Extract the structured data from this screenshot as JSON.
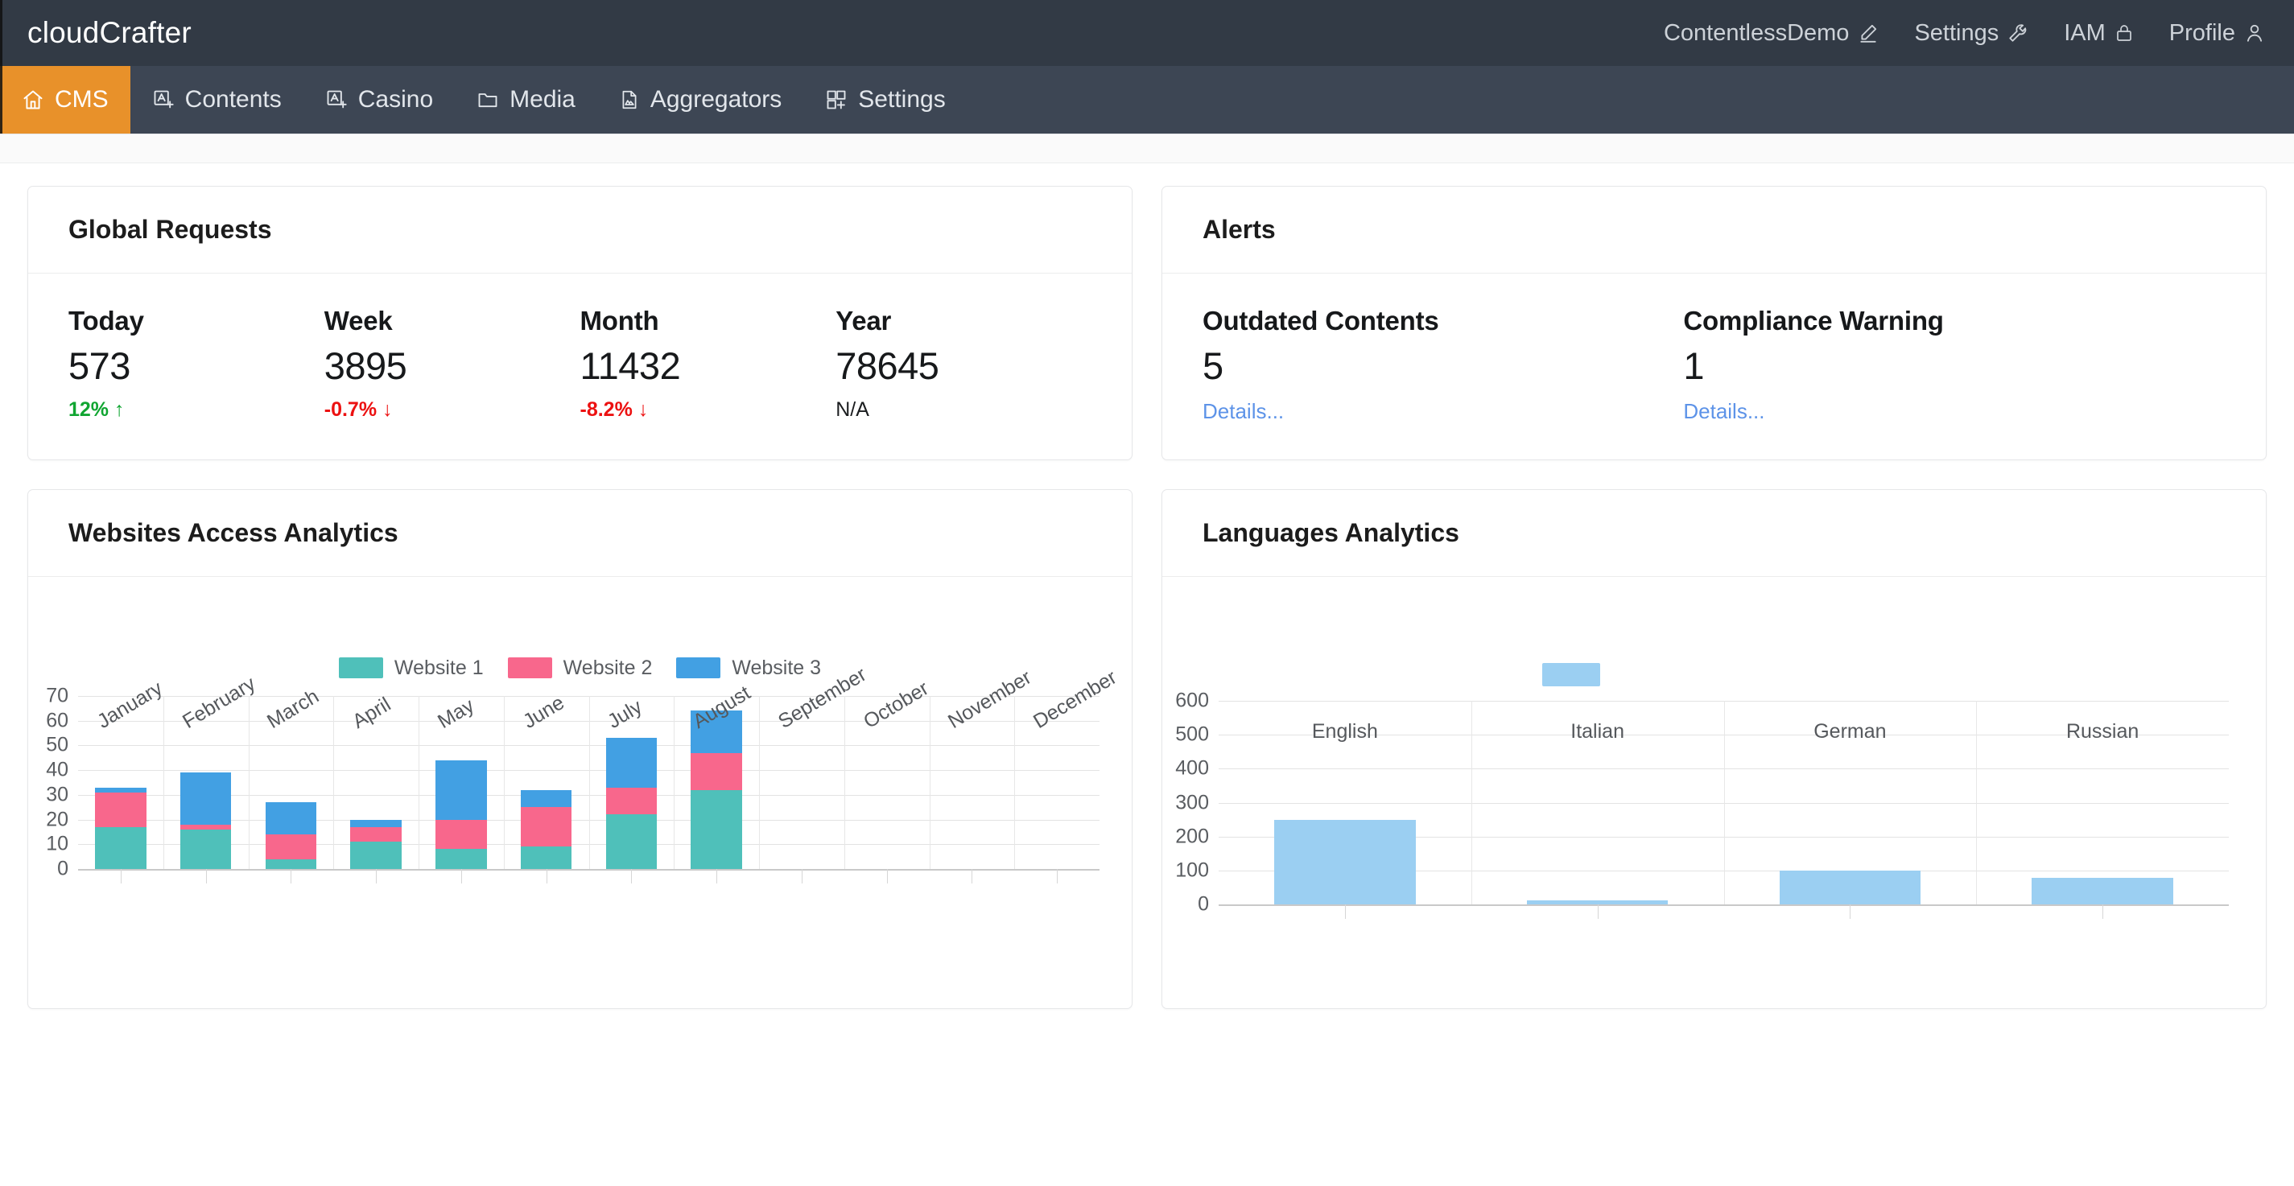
{
  "brand": {
    "text_light": "cloud",
    "text_bold": "Crafter",
    "full": "cloudCrafter"
  },
  "topnav": [
    {
      "label": "ContentlessDemo",
      "icon": "pencil-icon"
    },
    {
      "label": "Settings",
      "icon": "wrench-icon"
    },
    {
      "label": "IAM",
      "icon": "lock-icon"
    },
    {
      "label": "Profile",
      "icon": "user-icon"
    }
  ],
  "tabs": [
    {
      "label": "CMS",
      "icon": "home-icon",
      "active": true
    },
    {
      "label": "Contents",
      "icon": "text-add-icon",
      "active": false
    },
    {
      "label": "Casino",
      "icon": "text-add-icon",
      "active": false
    },
    {
      "label": "Media",
      "icon": "folder-icon",
      "active": false
    },
    {
      "label": "Aggregators",
      "icon": "document-image-icon",
      "active": false
    },
    {
      "label": "Settings",
      "icon": "grid-add-icon",
      "active": false
    }
  ],
  "cards": {
    "global_requests": {
      "title": "Global Requests",
      "stats": [
        {
          "label": "Today",
          "value": "573",
          "delta": "12%",
          "direction": "up",
          "arrow": "↑"
        },
        {
          "label": "Week",
          "value": "3895",
          "delta": "-0.7%",
          "direction": "down",
          "arrow": "↓"
        },
        {
          "label": "Month",
          "value": "11432",
          "delta": "-8.2%",
          "direction": "down",
          "arrow": "↓"
        },
        {
          "label": "Year",
          "value": "78645",
          "delta": "N/A",
          "direction": "flat",
          "arrow": ""
        }
      ]
    },
    "alerts": {
      "title": "Alerts",
      "stats": [
        {
          "label": "Outdated Contents",
          "value": "5",
          "link": "Details..."
        },
        {
          "label": "Compliance Warning",
          "value": "1",
          "link": "Details..."
        }
      ]
    },
    "websites_access": {
      "title": "Websites Access Analytics"
    },
    "languages": {
      "title": "Languages Analytics"
    }
  },
  "colors": {
    "accent_orange": "#e8912a",
    "topbar": "#323a45",
    "tabstrip": "#3d4654",
    "up_green": "#10a531",
    "down_red": "#ec1111",
    "link_blue": "#5d93e8",
    "website1_teal": "#4fc0ba",
    "website2_pink": "#f8678c",
    "website3_blue": "#42a0e3",
    "language_blue": "#9bcff2"
  },
  "chart_data": [
    {
      "type": "bar",
      "stacked": true,
      "title": "Websites Access Analytics",
      "xlabel": "",
      "ylabel": "",
      "ylim": [
        0,
        70
      ],
      "yticks": [
        0,
        10,
        20,
        30,
        40,
        50,
        60,
        70
      ],
      "grid": true,
      "legend_position": "top-center",
      "categories": [
        "January",
        "February",
        "March",
        "April",
        "May",
        "June",
        "July",
        "August",
        "September",
        "October",
        "November",
        "December"
      ],
      "series": [
        {
          "name": "Website 1",
          "color": "#4fc0ba",
          "values": [
            17,
            16,
            4,
            11,
            8,
            9,
            22,
            32,
            0,
            0,
            0,
            0
          ]
        },
        {
          "name": "Website 2",
          "color": "#f8678c",
          "values": [
            14,
            2,
            10,
            6,
            12,
            16,
            11,
            15,
            0,
            0,
            0,
            0
          ]
        },
        {
          "name": "Website 3",
          "color": "#42a0e3",
          "values": [
            2,
            21,
            13,
            3,
            24,
            7,
            20,
            17,
            0,
            0,
            0,
            0
          ]
        }
      ],
      "totals": [
        33,
        39,
        27,
        20,
        44,
        32,
        53,
        64,
        0,
        0,
        0,
        0
      ]
    },
    {
      "type": "bar",
      "stacked": false,
      "title": "Languages Analytics",
      "xlabel": "",
      "ylabel": "",
      "ylim": [
        0,
        600
      ],
      "yticks": [
        0,
        100,
        200,
        300,
        400,
        500,
        600
      ],
      "grid": true,
      "legend_position": "top-center",
      "legend_entries": [
        {
          "name": "",
          "color": "#9bcff2"
        }
      ],
      "categories": [
        "English",
        "Italian",
        "German",
        "Russian"
      ],
      "values": [
        250,
        13,
        100,
        78
      ],
      "color": "#9bcff2"
    }
  ]
}
